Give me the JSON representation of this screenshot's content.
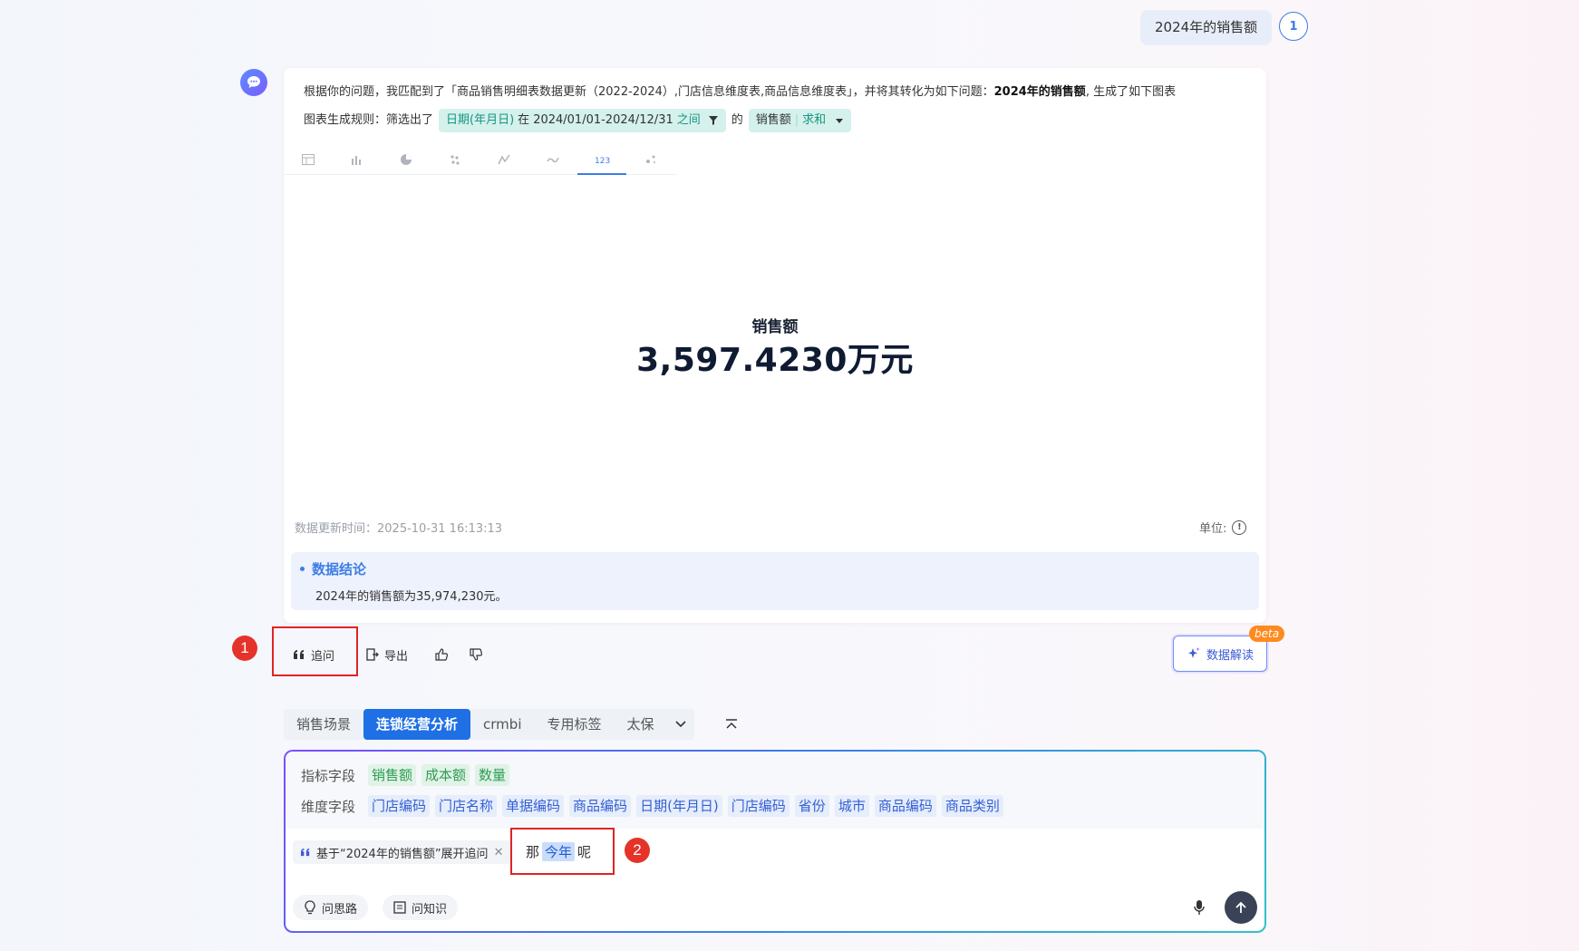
{
  "user_message": {
    "text": "2024年的销售额",
    "badge": "1"
  },
  "answer": {
    "intro_prefix": "根据你的问题，我匹配到了「商品销售明细表数据更新（2022-2024）,门店信息维度表,商品信息维度表」，并将其转化为如下问题：",
    "intro_bold": "2024年的销售额",
    "intro_suffix": ", 生成了如下图表",
    "rule_label": "图表生成规则：筛选出了",
    "filter_field": "日期(年月日)",
    "filter_in": "在",
    "filter_range": "2024/01/01-2024/12/31",
    "filter_between": "之间",
    "rule_of": "的",
    "metric_field": "销售额",
    "metric_agg": "求和",
    "chart_tabs": [
      "table-icon",
      "bar-chart-icon",
      "pie-chart-icon",
      "scatter-icon",
      "line-chart-icon",
      "area-chart-icon",
      "number-card-icon",
      "bubble-icon"
    ],
    "active_chart_tab": 6,
    "kpi_label": "销售额",
    "kpi_value": "3,597.4230万元",
    "update_time": "数据更新时间：2025-10-31 16:13:13",
    "unit_label": "单位:",
    "conclusion_title": "数据结论",
    "conclusion_text": "2024年的销售额为35,974,230元。"
  },
  "actions": {
    "followup": "追问",
    "export": "导出",
    "interpret": "数据解读",
    "beta": "beta",
    "marker1": "1",
    "marker2": "2"
  },
  "scenes": {
    "tabs": [
      "销售场景",
      "连锁经营分析",
      "crmbi",
      "专用标签",
      "太保"
    ],
    "active": 1
  },
  "input": {
    "metric_label": "指标字段",
    "metrics": [
      "销售额",
      "成本额",
      "数量"
    ],
    "dimension_label": "维度字段",
    "dimensions": [
      "门店编码",
      "门店名称",
      "单据编码",
      "商品编码",
      "日期(年月日)",
      "门店编码",
      "省份",
      "城市",
      "商品编码",
      "商品类别"
    ],
    "reference_chip": "基于“2024年的销售额”展开追问",
    "query_before": "那",
    "query_highlight": "今年",
    "query_after": "呢",
    "think_btn": "问思路",
    "knowledge_btn": "问知识"
  },
  "colors": {
    "accent": "#3b7de6",
    "marker_red": "#e5332a",
    "pill_teal": "#17957f"
  }
}
